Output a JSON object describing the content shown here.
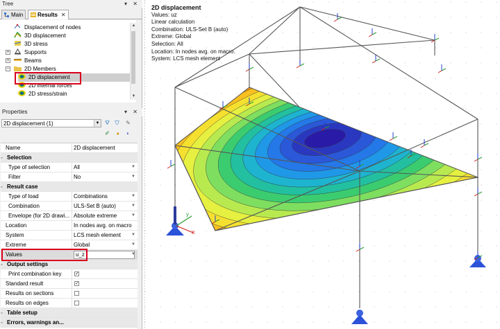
{
  "tree_panel": {
    "title": "Tree",
    "tabs": [
      {
        "label": "Main"
      },
      {
        "label": "Results"
      }
    ],
    "items": [
      {
        "label": "Displacement of nodes"
      },
      {
        "label": "3D displacement"
      },
      {
        "label": "3D stress"
      },
      {
        "label": "Supports"
      },
      {
        "label": "Beams"
      },
      {
        "label": "2D Members"
      },
      {
        "label": "2D displacement"
      },
      {
        "label": "2D internal forces"
      },
      {
        "label": "2D stress/strain"
      }
    ]
  },
  "properties_panel": {
    "title": "Properties",
    "combo_value": "2D displacement (1)",
    "rows": {
      "name": {
        "label": "Name",
        "value": "2D displacement"
      },
      "selection_header": "Selection",
      "type_of_selection": {
        "label": "Type of selection",
        "value": "All"
      },
      "filter": {
        "label": "Filter",
        "value": "No"
      },
      "result_case_header": "Result case",
      "type_of_load": {
        "label": "Type of load",
        "value": "Combinations"
      },
      "combination": {
        "label": "Combination",
        "value": "ULS-Set B (auto)"
      },
      "envelope": {
        "label": "Envelope (for 2D drawi...",
        "value": "Absolute extreme"
      },
      "location": {
        "label": "Location",
        "value": "In nodes avg. on macro"
      },
      "system": {
        "label": "System",
        "value": "LCS mesh element"
      },
      "extreme": {
        "label": "Extreme",
        "value": "Global"
      },
      "values": {
        "label": "Values",
        "value": "u_z"
      },
      "output_header": "Output settings",
      "print_combination_key": {
        "label": "Print combination key"
      },
      "standard_result": {
        "label": "Standard result"
      },
      "results_on_sections": {
        "label": "Results on sections"
      },
      "results_on_edges": {
        "label": "Results on edges"
      },
      "table_setup_header": "Table setup",
      "errors_header": "Errors, warnings an..."
    }
  },
  "viewport_info": {
    "title": "2D displacement",
    "lines": [
      "Values: uz",
      "Linear calculation",
      "Combination: ULS-Set B (auto)",
      "Extreme: Global",
      "Selection: All",
      "Location: In nodes avg. on macro.",
      "System: LCS mesh element"
    ]
  },
  "colors": {
    "highlight_box": "#d9001c",
    "contour_min": "#2a1aa8",
    "contour_max": "#e01010"
  }
}
